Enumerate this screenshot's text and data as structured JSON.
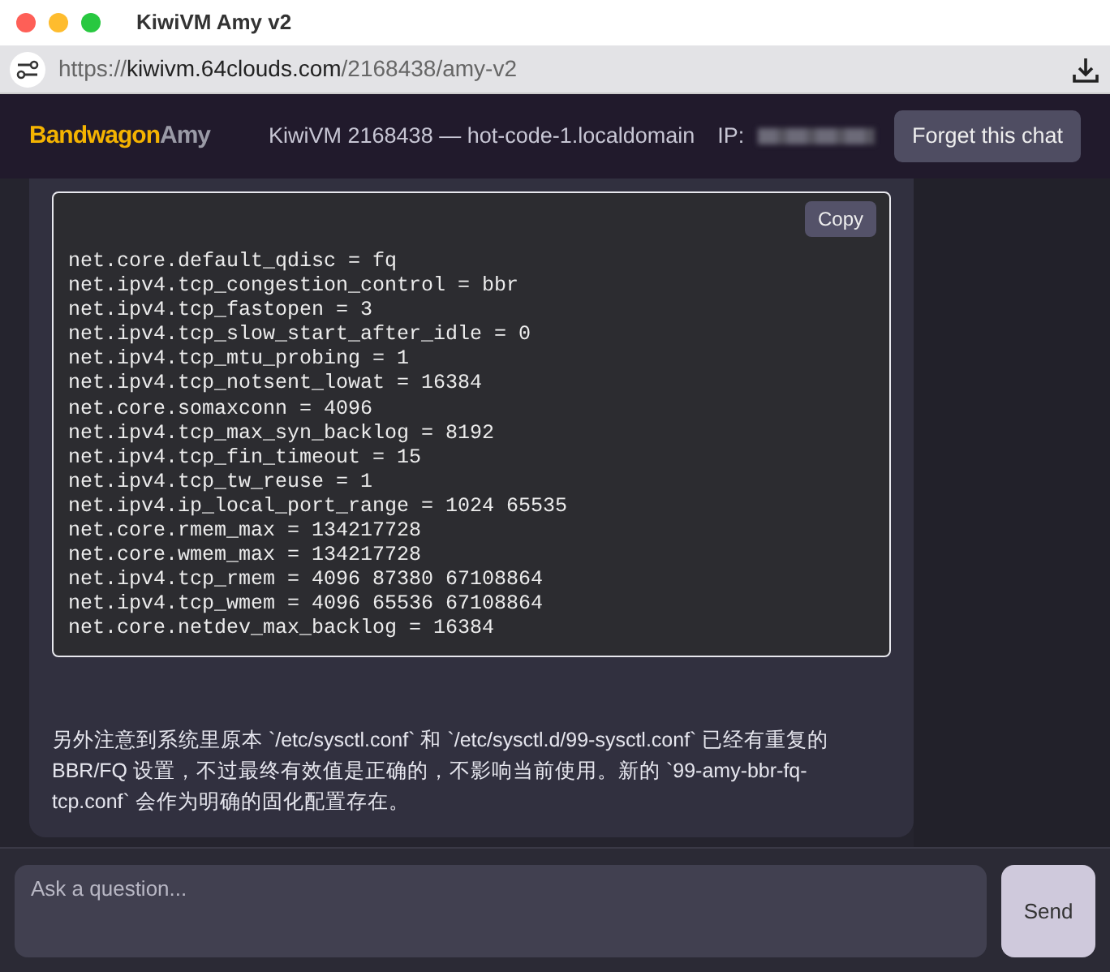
{
  "window": {
    "title": "KiwiVM Amy v2"
  },
  "address_bar": {
    "url_scheme": "https://",
    "url_host": "kiwivm.64clouds.com",
    "url_path": "/2168438/amy-v2"
  },
  "header": {
    "logo_primary": "Bandwagon",
    "logo_secondary": "Amy",
    "server": "KiwiVM 2168438 — hot-code-1.localdomain",
    "ip_label": "IP:",
    "forget_button": "Forget this chat"
  },
  "message": {
    "copy_button": "Copy",
    "code_lines": [
      "net.core.default_qdisc = fq",
      "net.ipv4.tcp_congestion_control = bbr",
      "net.ipv4.tcp_fastopen = 3",
      "net.ipv4.tcp_slow_start_after_idle = 0",
      "net.ipv4.tcp_mtu_probing = 1",
      "net.ipv4.tcp_notsent_lowat = 16384",
      "net.core.somaxconn = 4096",
      "net.ipv4.tcp_max_syn_backlog = 8192",
      "net.ipv4.tcp_fin_timeout = 15",
      "net.ipv4.tcp_tw_reuse = 1",
      "net.ipv4.ip_local_port_range = 1024 65535",
      "net.core.rmem_max = 134217728",
      "net.core.wmem_max = 134217728",
      "net.ipv4.tcp_rmem = 4096 87380 67108864",
      "net.ipv4.tcp_wmem = 4096 65536 67108864",
      "net.core.netdev_max_backlog = 16384"
    ],
    "paragraph": "另外注意到系统里原本 `/etc/sysctl.conf` 和 `/etc/sysctl.d/99-sysctl.conf` 已经有重复的 BBR/FQ 设置，不过最终有效值是正确的，不影响当前使用。新的 `99-amy-bbr-fq-tcp.conf` 会作为明确的固化配置存在。"
  },
  "composer": {
    "placeholder": "Ask a question...",
    "send_button": "Send"
  }
}
